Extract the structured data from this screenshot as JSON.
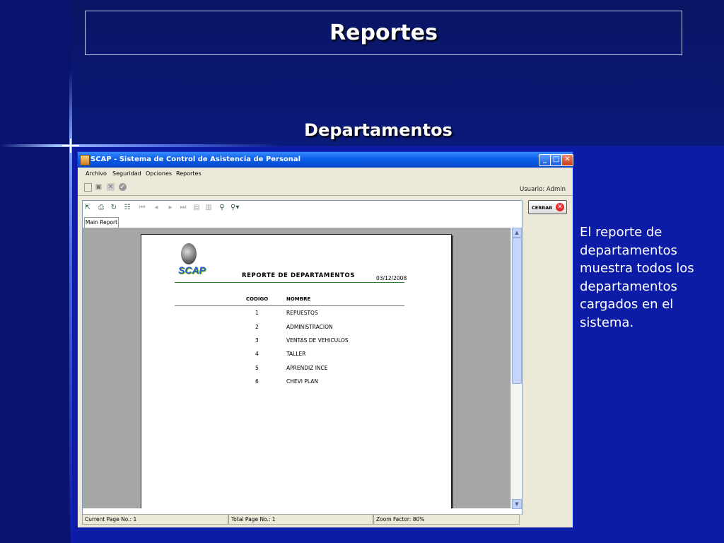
{
  "slide": {
    "title": "Reportes",
    "subtitle": "Departamentos",
    "description": "El reporte de departamentos muestra todos los departamentos cargados en el sistema."
  },
  "window": {
    "title": "SCAP - Sistema de Control de Asistencia de Personal",
    "menu": [
      "Archivo",
      "Seguridad",
      "Opciones",
      "Reportes"
    ],
    "user_label": "Usuario: Admin",
    "close_button": "CERRAR"
  },
  "viewer": {
    "tab": "Main Report",
    "status": {
      "current_page": "Current Page No.: 1",
      "total_page": "Total Page No.: 1",
      "zoom": "Zoom Factor: 80%"
    }
  },
  "report": {
    "logo": "SCAP",
    "title": "REPORTE  DE  DEPARTAMENTOS",
    "date": "03/12/2008",
    "columns": [
      "CODIGO",
      "NOMBRE"
    ],
    "rows": [
      {
        "codigo": "1",
        "nombre": "REPUESTOS"
      },
      {
        "codigo": "2",
        "nombre": "ADMINISTRACION"
      },
      {
        "codigo": "3",
        "nombre": "VENTAS DE VEHICULOS"
      },
      {
        "codigo": "4",
        "nombre": "TALLER"
      },
      {
        "codigo": "5",
        "nombre": "APRENDIZ INCE"
      },
      {
        "codigo": "6",
        "nombre": "CHEVI PLAN"
      }
    ]
  },
  "colors": {
    "slide_bg": "#0d1ca6",
    "title_bar": "#0a5fe8",
    "report_rule": "#2c7f2c"
  }
}
